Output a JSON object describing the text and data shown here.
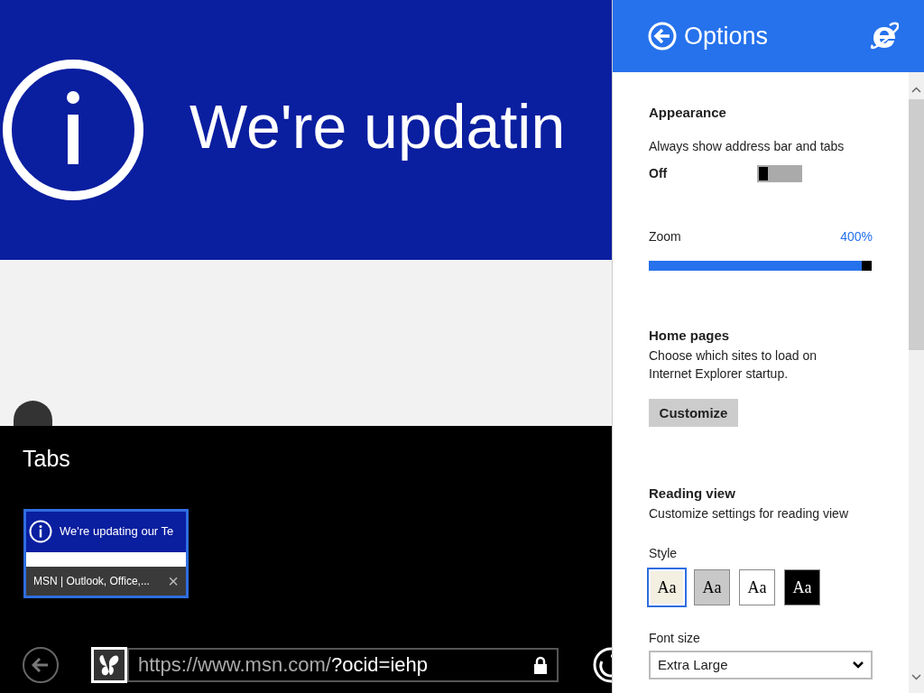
{
  "page": {
    "heading": "We're updatin"
  },
  "tabs_panel": {
    "title": "Tabs",
    "tabs": [
      {
        "preview_text": "We're updating our Te",
        "title": "MSN | Outlook, Office,...",
        "close": "×",
        "selected": true
      }
    ]
  },
  "address_bar": {
    "url_host": "https://www.msn.com/",
    "url_rest": "?ocid=iehp"
  },
  "options": {
    "title": "Options",
    "appearance": {
      "heading": "Appearance",
      "label": "Always show address bar and tabs",
      "state_text": "Off",
      "on": false
    },
    "zoom": {
      "label": "Zoom",
      "reading": "400%",
      "level": 1
    },
    "home_pages": {
      "heading": "Home pages",
      "description": "Choose which sites to load on Internet Explorer startup.",
      "button": "Customize"
    },
    "reading_view": {
      "heading": "Reading view",
      "description": "Customize settings for reading view",
      "style_label": "Style",
      "styles": [
        {
          "label": "Aa",
          "color": "#f3efe1",
          "selected": true
        },
        {
          "label": "Aa",
          "color": "#c8c8c8",
          "selected": false
        },
        {
          "label": "Aa",
          "color": "#ffffff",
          "selected": false
        },
        {
          "label": "Aa",
          "color": "#000000",
          "selected": false
        }
      ],
      "font_size_label": "Font size",
      "font_size": "Extra Large"
    }
  }
}
